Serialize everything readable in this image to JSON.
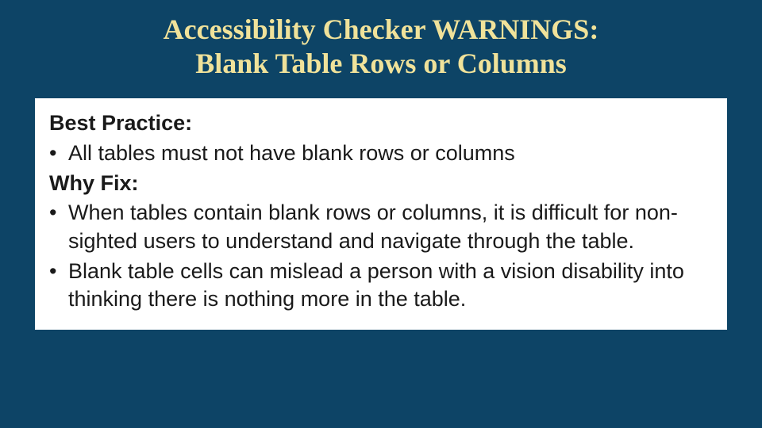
{
  "title_line1": "Accessibility Checker WARNINGS:",
  "title_line2": "Blank Table Rows or Columns",
  "best_practice_label": "Best Practice:",
  "best_practice_items": [
    "All tables must not have blank rows or columns"
  ],
  "why_fix_label": "Why Fix:",
  "why_fix_items": [
    "When tables contain blank rows or columns, it is difficult for non-sighted users to understand and navigate through the table.",
    "Blank table cells can mislead a person with a vision disability into thinking there is nothing more in the table."
  ],
  "bullet_glyph": "•"
}
